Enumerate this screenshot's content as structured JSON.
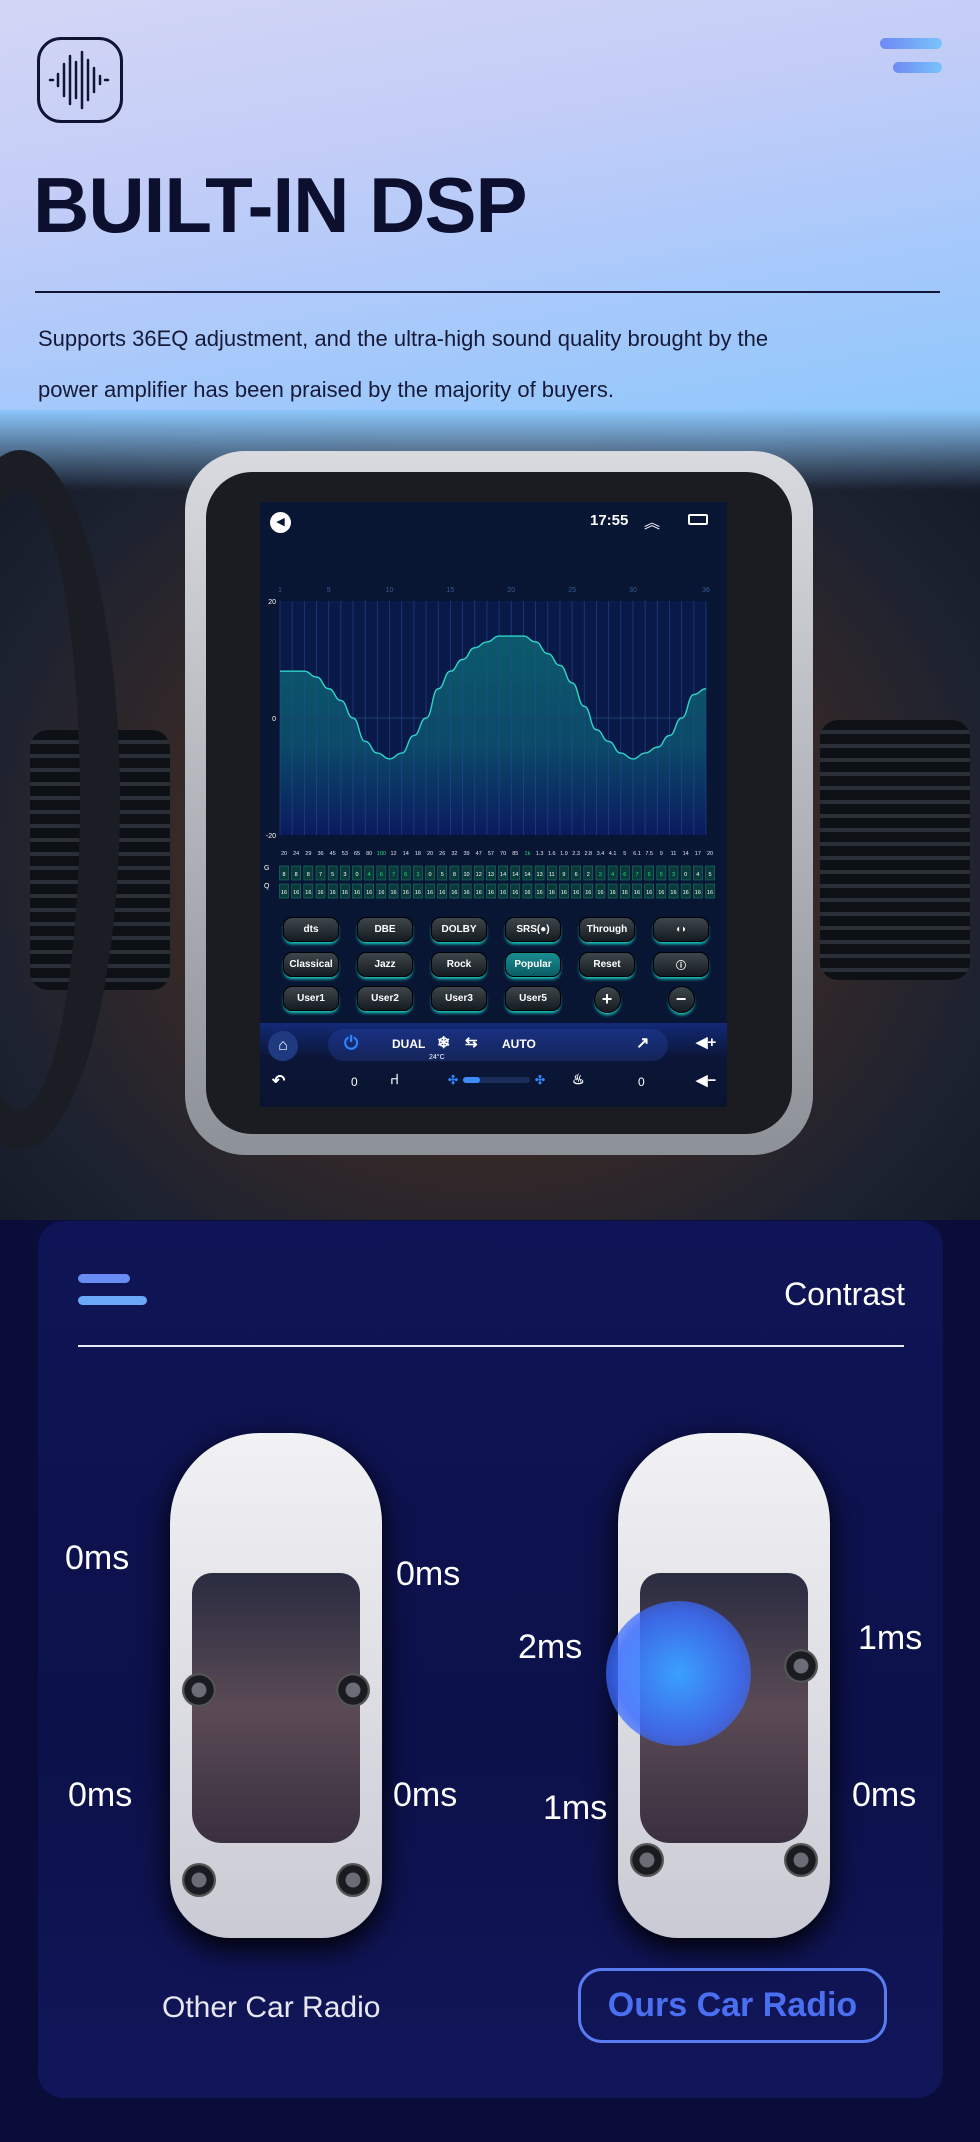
{
  "header": {
    "title": "BUILT-IN DSP",
    "description_lines": [
      "Supports 36EQ adjustment, and the ultra-high sound quality brought by the",
      "power amplifier has been praised by the majority of buyers."
    ],
    "logo_icon": "sound-wave-icon",
    "menu_icon": "menu-icon"
  },
  "screen": {
    "status": {
      "time": "17:55",
      "icons": [
        "back-icon",
        "double-chevron-up-icon",
        "window-icon"
      ]
    },
    "eq": {
      "band_index_labels": [
        "1",
        "5",
        "10",
        "15",
        "20",
        "25",
        "30",
        "36"
      ],
      "y_labels": [
        "20",
        "0",
        "-20"
      ],
      "ylim": [
        -20,
        20
      ],
      "row_labels": {
        "g": "G",
        "q": "Q"
      },
      "freqs": [
        "20",
        "24",
        "29",
        "36",
        "45",
        "53",
        "65",
        "80",
        "100",
        "12",
        "14",
        "18",
        "20",
        "26",
        "32",
        "39",
        "47",
        "57",
        "70",
        "85",
        "1k",
        "1.3",
        "1.6",
        "1.9",
        "2.3",
        "2.8",
        "3.4",
        "4.1",
        "5",
        "6.1",
        "7.5",
        "9",
        "11",
        "14",
        "17",
        "20"
      ],
      "highlight_freqs": [
        "100",
        "1k"
      ],
      "g": [
        8,
        8,
        8,
        7,
        5,
        3,
        0,
        -4,
        -6,
        -7,
        -6,
        -3,
        0,
        5,
        8,
        10,
        12,
        13,
        14,
        14,
        14,
        13,
        11,
        9,
        6,
        2,
        -2,
        -4,
        -6,
        -7,
        -6,
        -5,
        -3,
        0,
        4,
        5
      ],
      "q": [
        16,
        16,
        16,
        16,
        16,
        16,
        16,
        16,
        16,
        16,
        16,
        16,
        16,
        16,
        16,
        16,
        16,
        16,
        16,
        16,
        16,
        16,
        16,
        16,
        16,
        16,
        16,
        16,
        16,
        16,
        16,
        16,
        16,
        16,
        16,
        16
      ],
      "colors": {
        "curve": "#2fd6c9",
        "negative": "#22e07a",
        "fill_top": "#0b5a6a",
        "fill_bottom": "#0b1a5e"
      }
    },
    "buttons": [
      [
        "dts",
        "DBE",
        "DOLBY",
        "SRS(●)",
        "Through",
        "◖◗"
      ],
      [
        "Classical",
        "Jazz",
        "Rock",
        "Popular",
        "Reset",
        "ⓘ"
      ],
      [
        "User1",
        "User2",
        "User3",
        "User5",
        "+",
        "−"
      ]
    ],
    "active_button": "Popular",
    "climate": {
      "dual": "DUAL",
      "auto": "AUTO",
      "temp": "24°C",
      "left_value": "0",
      "right_value": "0",
      "fan_level": 0.25
    }
  },
  "contrast": {
    "title": "Contrast",
    "other": {
      "label": "Other Car Radio",
      "delays": {
        "front_left": "0ms",
        "front_right": "0ms",
        "rear_left": "0ms",
        "rear_right": "0ms"
      }
    },
    "ours": {
      "label": "Ours Car Radio",
      "delays": {
        "front_left": "2ms",
        "front_right": "1ms",
        "rear_left": "1ms",
        "rear_right": "0ms"
      }
    },
    "accent": "#4a5cf0"
  }
}
